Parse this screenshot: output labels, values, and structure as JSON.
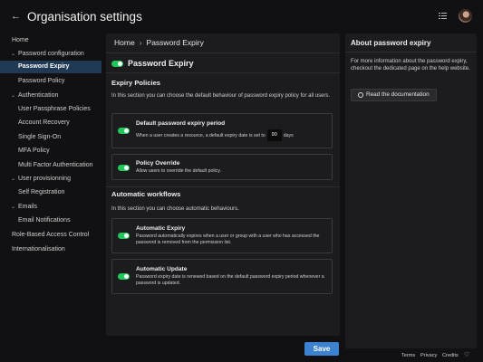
{
  "header": {
    "back_icon": "arrow-left-icon",
    "title": "Organisation settings",
    "apps_icon": "apps-icon"
  },
  "sidebar": {
    "items": [
      {
        "label": "Home"
      },
      {
        "label": "Password configuration",
        "expanded": true
      },
      {
        "label": "Password Expiry",
        "selected": true
      },
      {
        "label": "Password Policy"
      },
      {
        "label": "Authentication",
        "expanded": true
      },
      {
        "label": "User Passphrase Policies"
      },
      {
        "label": "Account Recovery"
      },
      {
        "label": "Single Sign-On"
      },
      {
        "label": "MFA Policy"
      },
      {
        "label": "Multi Factor Authentication"
      },
      {
        "label": "User provisionning",
        "expanded": true
      },
      {
        "label": "Self Registration"
      },
      {
        "label": "Emails",
        "expanded": true
      },
      {
        "label": "Email Notifications"
      },
      {
        "label": "Role-Based Access Control"
      },
      {
        "label": "Internationalisation"
      }
    ]
  },
  "breadcrumb": {
    "home": "Home",
    "separator": "›",
    "current": "Password Expiry"
  },
  "main": {
    "title": "Password Expiry",
    "title_enabled": true,
    "expiry_policies": {
      "heading": "Expiry Policies",
      "description": "In this section you can choose the default behaviour of password expiry policy for all users.",
      "default_period": {
        "title": "Default password expiry period",
        "text_before": "When a user creates a resource, a default expiry date is set to",
        "days_value": "90",
        "text_after": "days",
        "enabled": true
      },
      "policy_override": {
        "title": "Policy Override",
        "description": "Allow users to override the default policy.",
        "enabled": true
      }
    },
    "automatic_workflows": {
      "heading": "Automatic workflows",
      "description": "In this section you can choose automatic behaviours.",
      "automatic_expiry": {
        "title": "Automatic Expiry",
        "description": "Password automatically expires when a user or group with a user who has accessed the password is removed from the permission list.",
        "enabled": true
      },
      "automatic_update": {
        "title": "Automatic Update",
        "description": "Password expiry date is renewed based on the default password expiry period whenever a password is updated.",
        "enabled": true
      }
    }
  },
  "save_label": "Save",
  "aside": {
    "title": "About password expiry",
    "text": "For more information about the password expiry, checkout the dedicated page on the help website.",
    "button_label": "Read the documentation"
  },
  "footer": {
    "terms": "Terms",
    "privacy": "Privacy",
    "credits": "Credits",
    "heart_icon": "heart-icon"
  },
  "colors": {
    "accent": "#3b82d1",
    "toggle_on": "#20c75b",
    "selected_nav": "#203a55",
    "background": "#111113",
    "panel": "#1c1c1f"
  }
}
